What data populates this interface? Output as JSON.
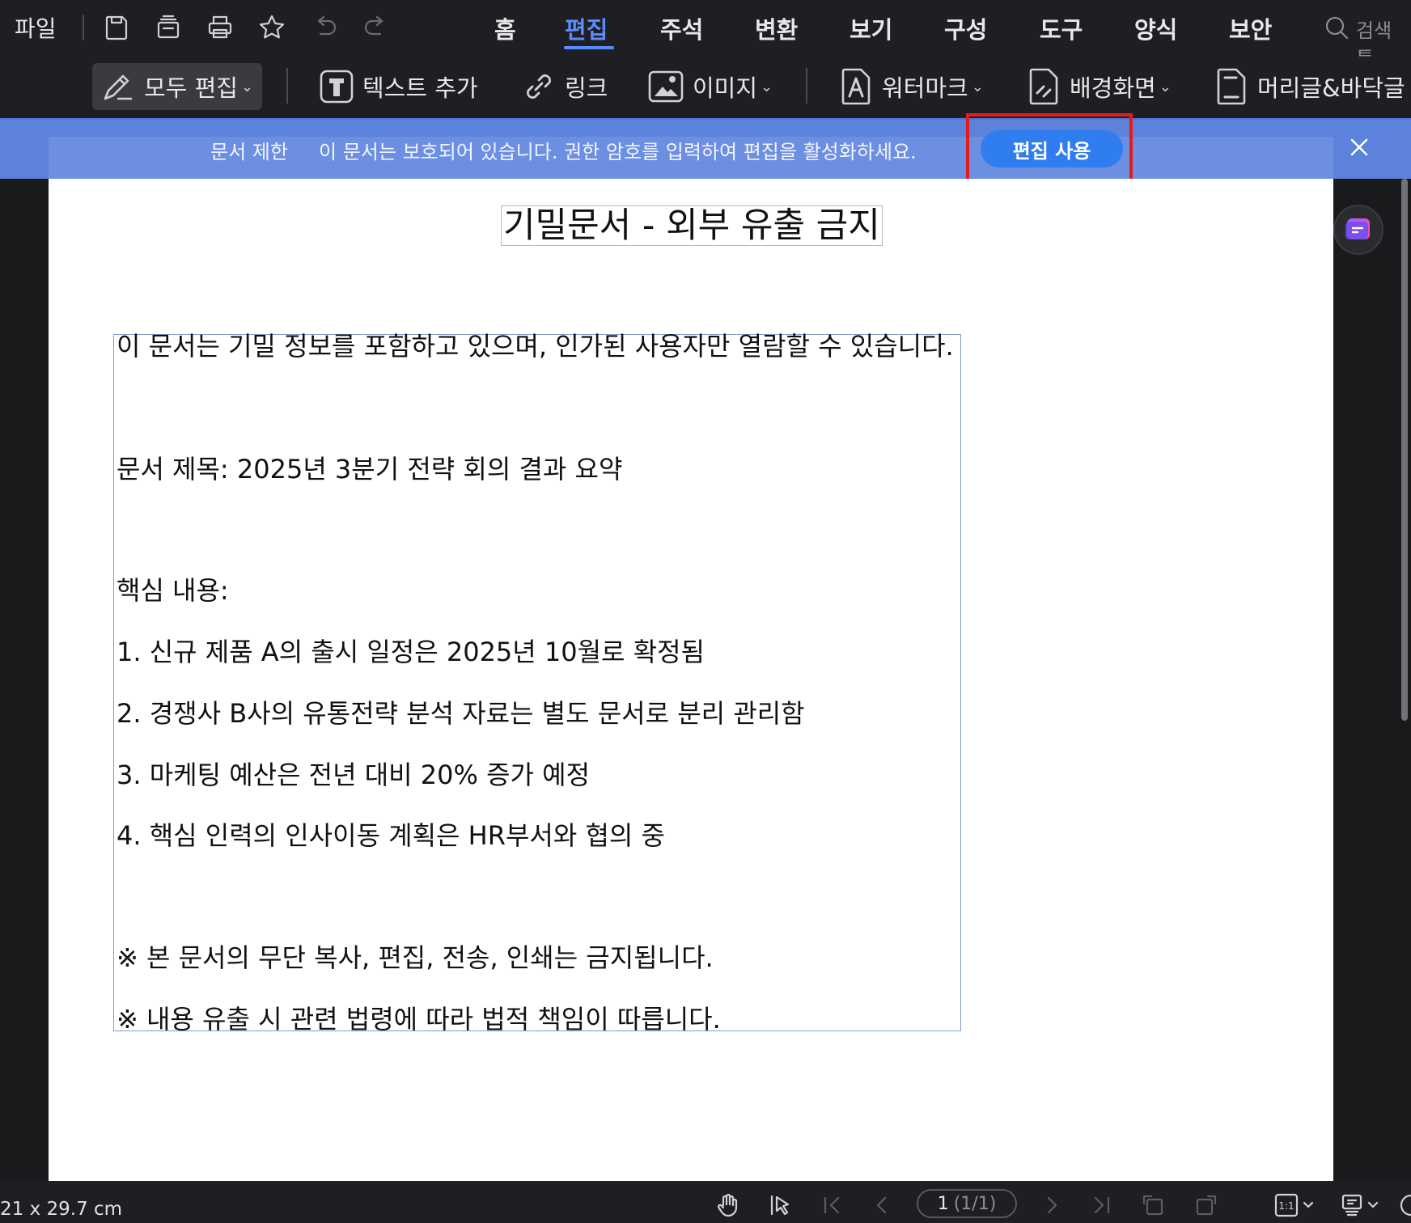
{
  "menu": {
    "file": "파일",
    "tabs": [
      {
        "label": "홈"
      },
      {
        "label": "편집",
        "active": true
      },
      {
        "label": "주석"
      },
      {
        "label": "변환"
      },
      {
        "label": "보기"
      },
      {
        "label": "구성"
      },
      {
        "label": "도구"
      },
      {
        "label": "양식"
      },
      {
        "label": "보안"
      }
    ],
    "search_placeholder": "검색 툴"
  },
  "toolbar": {
    "edit_all": "모두 편집",
    "add_text": "텍스트 추가",
    "link": "링크",
    "image": "이미지",
    "watermark": "워터마크",
    "background": "배경화면",
    "header_footer": "머리글&바닥글"
  },
  "notice": {
    "title": "문서 제한",
    "message": "이 문서는 보호되어 있습니다. 권한 암호를 입력하여 편집을 활성화하세요.",
    "button": "편집 사용"
  },
  "document": {
    "title": "기밀문서 - 외부 유출 금지",
    "lines": [
      "이 문서는 기밀 정보를 포함하고 있으며, 인가된 사용자만 열람할 수 있습니다.",
      "문서 제목: 2025년 3분기 전략 회의 결과 요약",
      "핵심 내용:",
      "1. 신규 제품 A의 출시 일정은 2025년 10월로 확정됨",
      "2. 경쟁사 B사의 유통전략 분석 자료는 별도 문서로 분리 관리함",
      "3. 마케팅 예산은 전년 대비 20% 증가 예정",
      "4. 핵심 인력의 인사이동 계획은 HR부서와 협의 중",
      "※ 본 문서의 무단 복사, 편집, 전송, 인쇄는 금지됩니다.",
      "※ 내용 유출 시 관련 법령에 따라 법적 책임이 따릅니다."
    ]
  },
  "status": {
    "page_size": "21 x 29.7 cm",
    "page_current": "1",
    "page_total": "(1/1)",
    "zoom_icon": "1:1"
  },
  "colors": {
    "accent": "#5a8cff",
    "notice_bar": "#5d82db",
    "button": "#2f7dee",
    "highlight": "#e41c1c"
  }
}
